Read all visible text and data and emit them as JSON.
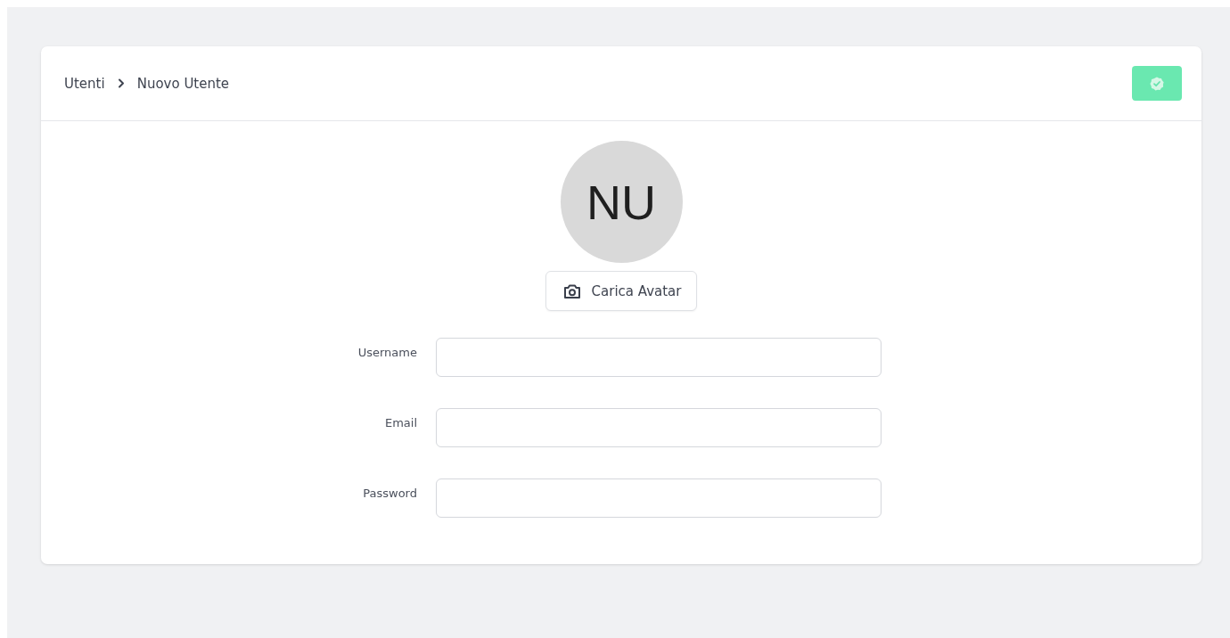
{
  "breadcrumb": [
    {
      "label": "Utenti"
    },
    {
      "label": "Nuovo Utente"
    }
  ],
  "avatar": {
    "initials": "NU"
  },
  "upload_button": {
    "label": "Carica Avatar"
  },
  "fields": [
    {
      "label": "Username"
    },
    {
      "label": "Email"
    },
    {
      "label": "Password"
    }
  ]
}
